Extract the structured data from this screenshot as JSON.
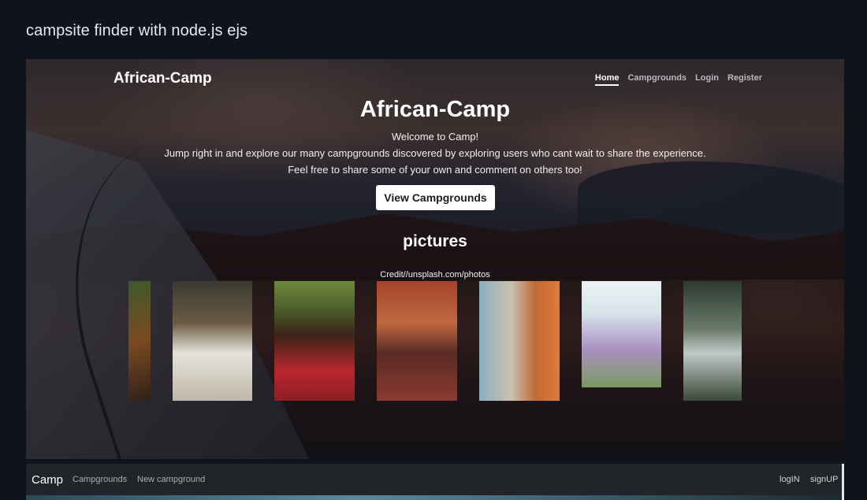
{
  "page": {
    "heading": "campsite finder with node.js ejs"
  },
  "hero": {
    "brand": "African-Camp",
    "nav": [
      "Home",
      "Campgrounds",
      "Login",
      "Register"
    ],
    "title": "African-Camp",
    "lines": [
      "Welcome to Camp!",
      "Jump right in and explore our many campgrounds discovered by exploring users who cant wait to share the experience.",
      "Feel free to share some of your own and comment on others too!"
    ],
    "cta": "View Campgrounds",
    "pictures_title": "pictures",
    "credit": "Credit//unsplash.com/photos"
  },
  "bottom_nav": {
    "brand": "Camp",
    "left_links": [
      "Campgrounds",
      "New campground"
    ],
    "right_links": [
      "logIN",
      "signUP"
    ]
  }
}
